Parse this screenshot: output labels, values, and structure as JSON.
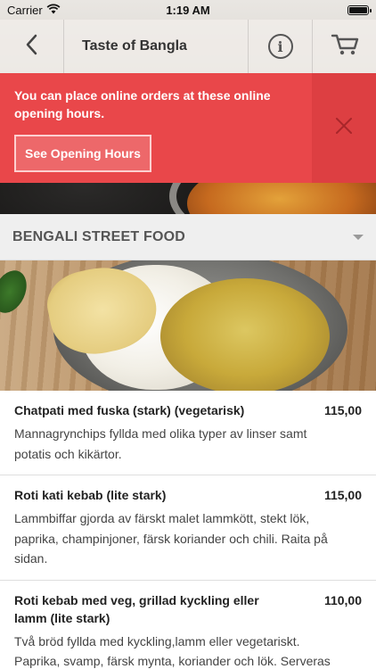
{
  "status_bar": {
    "carrier": "Carrier",
    "time": "1:19 AM"
  },
  "nav": {
    "title": "Taste of Bangla",
    "back_icon": "chevron-left-icon",
    "info_icon": "info-icon",
    "cart_icon": "cart-icon"
  },
  "banner": {
    "message": "You can place online orders at these online opening hours.",
    "button_label": "See Opening Hours",
    "background": "#e9474a"
  },
  "category": {
    "title": "BENGALI STREET FOOD"
  },
  "menu_items": [
    {
      "name": "Chatpati med fuska (stark) (vegetarisk)",
      "price": "115,00",
      "description": "Mannagrynchips fyllda med olika typer av linser samt potatis och kikärtor."
    },
    {
      "name": "Roti kati kebab (lite stark)",
      "price": "115,00",
      "description": "Lammbiffar gjorda av färskt malet lammkött, stekt lök, paprika, champinjoner, färsk koriander och chili. Raita på sidan."
    },
    {
      "name": "Roti kebab med veg, grillad kyckling eller lamm (lite stark)",
      "price": "110,00",
      "description": "Två bröd fyllda med kyckling,lamm eller vegetariskt. Paprika, svamp, färsk mynta, koriander och lök. Serveras med raita."
    }
  ]
}
